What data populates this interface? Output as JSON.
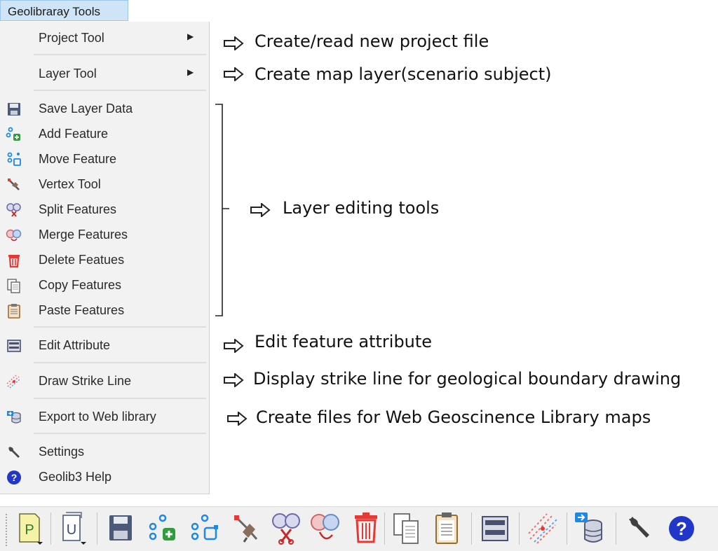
{
  "menu": {
    "title": "Geolibraray Tools",
    "items": [
      {
        "label": "Project Tool",
        "icon": "project-tool-icon",
        "submenu": true
      },
      {
        "label": "Layer Tool",
        "icon": "layer-tool-icon",
        "submenu": true
      },
      {
        "label": "Save Layer Data",
        "icon": "save-icon"
      },
      {
        "label": "Add Feature",
        "icon": "add-feature-icon"
      },
      {
        "label": "Move Feature",
        "icon": "move-feature-icon"
      },
      {
        "label": "Vertex Tool",
        "icon": "vertex-tool-icon"
      },
      {
        "label": "Split Features",
        "icon": "split-features-icon"
      },
      {
        "label": "Merge Features",
        "icon": "merge-features-icon"
      },
      {
        "label": "Delete Featues",
        "icon": "delete-icon"
      },
      {
        "label": "Copy Features",
        "icon": "copy-icon"
      },
      {
        "label": "Paste Features",
        "icon": "paste-icon"
      },
      {
        "label": "Edit Attribute",
        "icon": "edit-attribute-icon"
      },
      {
        "label": "Draw Strike Line",
        "icon": "strike-line-icon"
      },
      {
        "label": "Export to Web library",
        "icon": "export-web-icon"
      },
      {
        "label": "Settings",
        "icon": "settings-wrench-icon"
      },
      {
        "label": "Geolib3 Help",
        "icon": "help-icon"
      }
    ],
    "submenu_arrow": "▶"
  },
  "annotations": {
    "project": "Create/read new project file",
    "layer": "Create map layer(scenario subject)",
    "editing": "Layer editing tools",
    "attribute": "Edit feature attribute",
    "strike": "Display strike line for geological boundary drawing",
    "export": "Create files for Web Geoscinence Library maps"
  },
  "toolbar": {
    "buttons": [
      "project-tool-icon",
      "layer-tool-icon",
      "save-icon",
      "add-feature-icon",
      "move-feature-icon",
      "vertex-tool-icon",
      "split-features-icon",
      "merge-features-icon",
      "delete-icon",
      "copy-icon",
      "paste-icon",
      "edit-attribute-icon",
      "strike-line-icon",
      "export-web-icon",
      "settings-wrench-icon",
      "help-icon"
    ],
    "project_letter": "P",
    "layer_letter": "U",
    "help_glyph": "?"
  },
  "colors": {
    "menu_title_bg": "#cfe5f7",
    "menu_bg": "#f2f2f2",
    "toolbar_bg": "#f0f0f0",
    "accent_blue": "#1e88e5",
    "accent_green": "#2e9d3e",
    "accent_red": "#e53935",
    "help_blue": "#2236c9"
  }
}
